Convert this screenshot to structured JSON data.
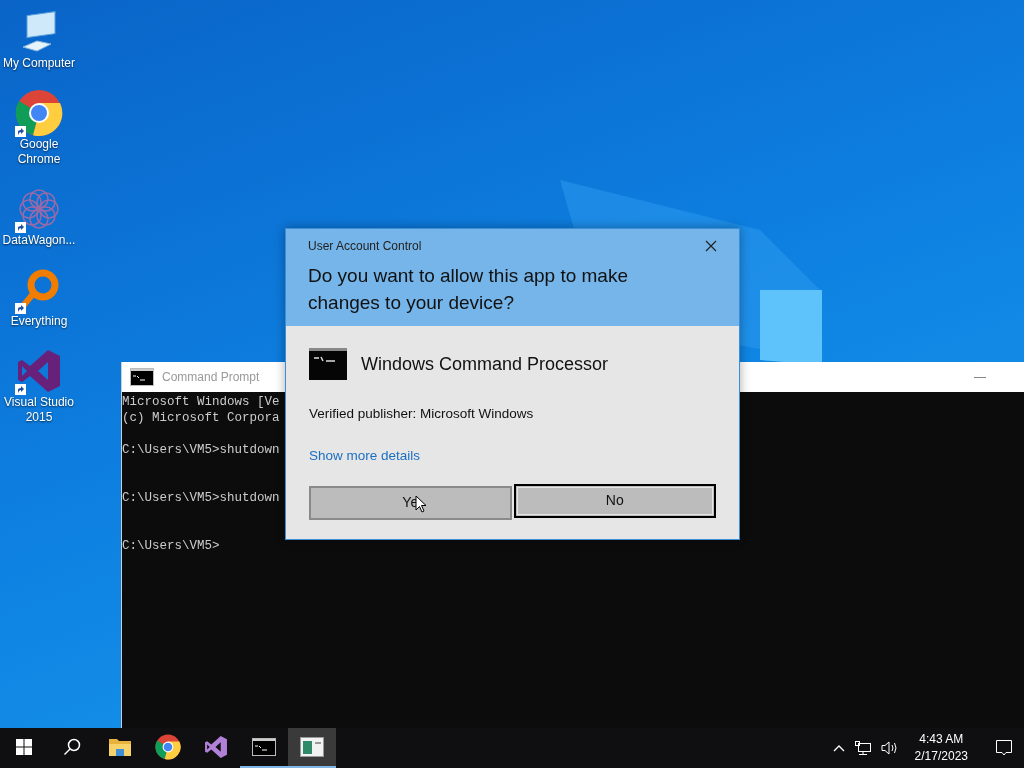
{
  "desktop_icons": [
    {
      "kind": "computer",
      "label": "My Computer",
      "shortcut": false
    },
    {
      "kind": "chrome",
      "label": "Google Chrome",
      "shortcut": true
    },
    {
      "kind": "datawagon",
      "label": "DataWagon...",
      "shortcut": true
    },
    {
      "kind": "everything",
      "label": "Everything",
      "shortcut": true
    },
    {
      "kind": "vs",
      "label": "Visual Studio 2015",
      "shortcut": true
    }
  ],
  "console_window": {
    "title": "Command Prompt",
    "minimize": "—",
    "blocks": [
      [
        "Microsoft Windows [Ve",
        "(c) Microsoft Corpora"
      ],
      [
        "C:\\Users\\VM5>shutdown"
      ],
      [
        "C:\\Users\\VM5>shutdown"
      ],
      [
        "C:\\Users\\VM5>"
      ]
    ]
  },
  "dialog": {
    "title": "User Account Control",
    "question": "Do you want to allow this app to make changes to your device?",
    "app_name": "Windows Command Processor",
    "publisher": "Verified publisher: Microsoft Windows",
    "details_link": "Show more details",
    "buttons": [
      {
        "label": "Ye",
        "focused": false,
        "cursor": true
      },
      {
        "label": "No",
        "focused": true,
        "cursor": false
      }
    ]
  },
  "taskbar": {
    "items": [
      {
        "kind": "start",
        "running": false,
        "selected": false
      },
      {
        "kind": "search",
        "running": false,
        "selected": false
      },
      {
        "kind": "explorer",
        "running": false,
        "selected": false
      },
      {
        "kind": "chrome",
        "running": false,
        "selected": false
      },
      {
        "kind": "vs",
        "running": false,
        "selected": false
      },
      {
        "kind": "cmd",
        "running": true,
        "selected": false
      },
      {
        "kind": "uac",
        "running": true,
        "selected": true
      }
    ],
    "time": "4:43 AM",
    "date": "2/17/2023"
  }
}
